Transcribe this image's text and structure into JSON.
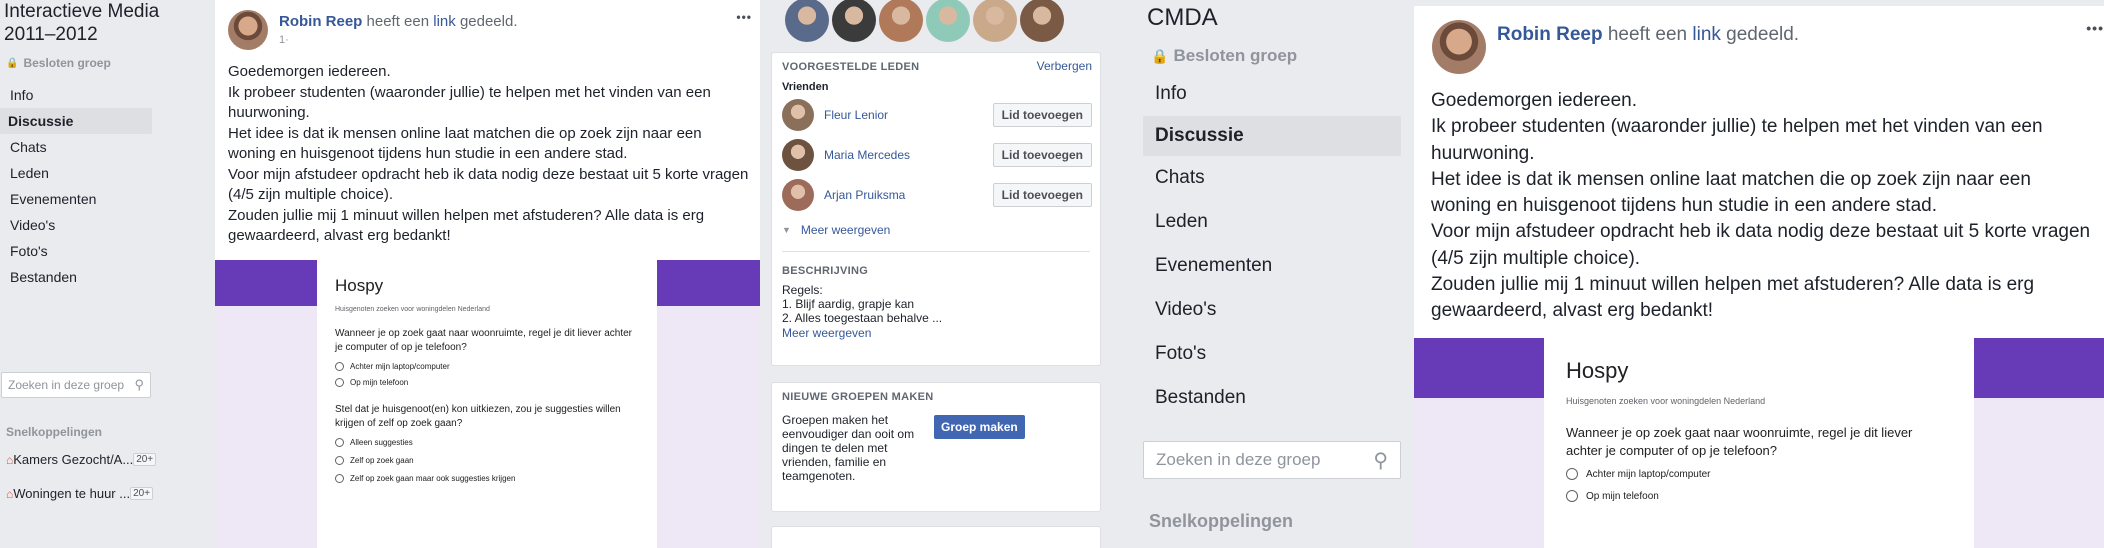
{
  "left_nav": {
    "group_title_line1": "Interactieve Media",
    "group_title_line2": "2011–2012",
    "closed_label": "Besloten groep",
    "menu": [
      "Info",
      "Discussie",
      "Chats",
      "Leden",
      "Evenementen",
      "Video's",
      "Foto's",
      "Bestanden"
    ],
    "active_item": "Discussie",
    "search_placeholder": "Zoeken in deze groep",
    "shortcuts_title": "Snelkoppelingen",
    "shortcuts": [
      {
        "label": "Kamers Gezocht/A...",
        "badge": "20+"
      },
      {
        "label": "Woningen te huur ...",
        "badge": "20+"
      }
    ]
  },
  "post": {
    "author": "Robin Reep",
    "verb_prefix": "heeft een",
    "link_word": "link",
    "verb_suffix": "gedeeld.",
    "time": "1·",
    "more": "•••",
    "lines": [
      "Goedemorgen iedereen.",
      "Ik probeer studenten (waaronder jullie) te helpen met het vinden van een huurwoning.",
      "Het idee is dat ik mensen online laat matchen die op zoek zijn naar een woning en huisgenoot tijdens hun studie in een andere stad.",
      "Voor mijn afstudeer opdracht heb ik data nodig deze bestaat uit 5 korte vragen (4/5 zijn multiple choice).",
      "Zouden jullie mij 1 minuut willen helpen met afstuderen? Alle data is erg gewaardeerd, alvast erg bedankt!"
    ],
    "form": {
      "title": "Hospy",
      "subtitle": "Huisgenoten zoeken voor woningdelen Nederland",
      "q1": "Wanneer je op zoek gaat naar woonruimte, regel je dit liever achter je computer of op je telefoon?",
      "q1_options": [
        "Achter mijn laptop/computer",
        "Op mijn telefoon"
      ],
      "q2": "Stel dat je huisgenoot(en) kon uitkiezen, zou je suggesties willen krijgen of zelf op zoek gaan?",
      "q2_options": [
        "Alleen suggesties",
        "Zelf op zoek gaan",
        "Zelf op zoek gaan maar ook suggesties krijgen"
      ]
    }
  },
  "right": {
    "suggested_title": "VOORGESTELDE LEDEN",
    "hide": "Verbergen",
    "friends_label": "Vrienden",
    "members": [
      {
        "name": "Fleur Lenior",
        "button": "Lid toevoegen",
        "color": "#8a6f5a"
      },
      {
        "name": "Maria Mercedes",
        "button": "Lid toevoegen",
        "color": "#6d5240"
      },
      {
        "name": "Arjan Pruiksma",
        "button": "Lid toevoegen",
        "color": "#9c6b5a"
      }
    ],
    "more": "Meer weergeven",
    "description_title": "BESCHRIJVING",
    "rules_label": "Regels:",
    "rule1": "1. Blijf aardig, grapje kan",
    "rule2": "2. Alles toegestaan behalve ...",
    "more2": "Meer weergeven",
    "new_groups_title": "NIEUWE GROEPEN MAKEN",
    "new_groups_text": "Groepen maken het eenvoudiger dan ooit om dingen te delen met vrienden, familie en teamgenoten.",
    "create_button": "Groep maken",
    "top_avatar_colors": [
      "#5a6a8a",
      "#3b3b3b",
      "#b07a5a",
      "#8fc9b8",
      "#c9a98a",
      "#7a5a44"
    ]
  },
  "zoom_nav": {
    "group_title": "CMDA",
    "closed_label": "Besloten groep",
    "menu": [
      "Info",
      "Discussie",
      "Chats",
      "Leden",
      "Evenementen",
      "Video's",
      "Foto's",
      "Bestanden"
    ],
    "active_item": "Discussie",
    "search_placeholder": "Zoeken in deze groep",
    "shortcuts_title": "Snelkoppelingen"
  }
}
